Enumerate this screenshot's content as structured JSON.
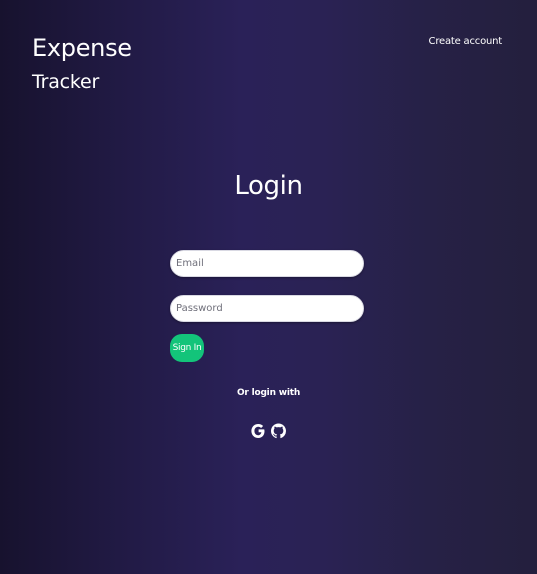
{
  "brand": {
    "line1": "Expense",
    "line2": "Tracker"
  },
  "nav": {
    "create_account": "Create account"
  },
  "login": {
    "title": "Login",
    "email_placeholder": "Email",
    "password_placeholder": "Password",
    "signin_label": "Sign In",
    "social_prompt": "Or login with"
  },
  "social": [
    {
      "icon": "google-icon"
    },
    {
      "icon": "github-icon"
    }
  ],
  "colors": {
    "accent": "#13c47a",
    "background": "#2a2158",
    "text": "#ffffff"
  }
}
